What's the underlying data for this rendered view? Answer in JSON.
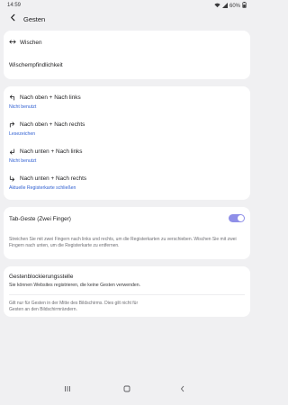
{
  "status": {
    "time": "14:59",
    "battery": "60%",
    "icons": [
      "wifi-icon",
      "signal-icon",
      "battery-icon"
    ]
  },
  "appbar": {
    "title": "Gesten"
  },
  "section1": {
    "swipe_label": "Wischen",
    "swipe_sensitivity_label": "Wischempfindlichkeit"
  },
  "section2": {
    "items": [
      {
        "label": "Nach oben + Nach links",
        "value": "Nicht benutzt",
        "icon": "arrow-up-left-icon"
      },
      {
        "label": "Nach oben + Nach rechts",
        "value": "Lesezeichen",
        "icon": "arrow-up-right-icon"
      },
      {
        "label": "Nach unten + Nach links",
        "value": "Nicht benutzt",
        "icon": "arrow-down-left-icon"
      },
      {
        "label": "Nach unten + Nach rechts",
        "value": "Aktuelle Registerkarte schließen",
        "icon": "arrow-down-right-icon"
      }
    ]
  },
  "section3": {
    "tab_gesture_label": "Tab-Geste (Zwei Finger)",
    "tab_gesture_enabled": true,
    "tab_gesture_help": "Streichen Sie mit zwei Fingern nach links und rechts, um die Registerkarten zu verschieben. Wischen Sie mit zwei Fingern nach unten, um die Registerkarte zu entfernen."
  },
  "section4": {
    "blocklist_label": "Gestenblockierungsstelle",
    "blocklist_sub": "Sie können Websites registrieren, die keine Gesten verwenden.",
    "note": "Gilt nur für Gesten in der Mitte des Bildschirms. Dies gilt nicht für Gesten an den Bildschirmrändern."
  },
  "nav": {
    "recents": "|||",
    "home": "◯",
    "back": "‹"
  }
}
